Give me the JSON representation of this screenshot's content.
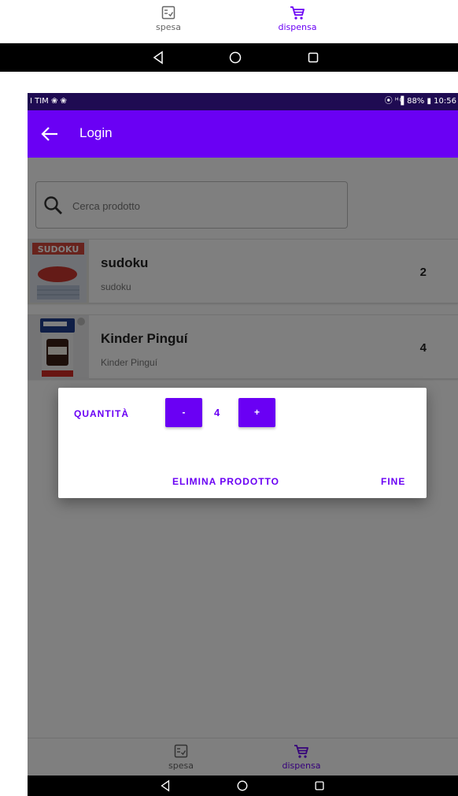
{
  "top_nav": {
    "items": [
      {
        "label": "spesa",
        "icon": "checklist-icon",
        "active": false
      },
      {
        "label": "dispensa",
        "icon": "cart-icon",
        "active": true
      }
    ]
  },
  "status_bar": {
    "carrier": "I TIM ❀ ❀",
    "right": "⦿ ᴴ ͩ▌88% ▮ 10:56",
    "battery": "88%",
    "time": "10:56"
  },
  "app_bar": {
    "title": "Login"
  },
  "search": {
    "placeholder": "Cerca prodotto"
  },
  "products": [
    {
      "name": "sudoku",
      "subtitle": "sudoku",
      "quantity": "2",
      "thumb_text": "SUDOKU"
    },
    {
      "name": "Kinder Pinguí",
      "subtitle": "Kinder Pinguí",
      "quantity": "4"
    }
  ],
  "bottom_nav": {
    "items": [
      {
        "label": "spesa",
        "icon": "checklist-icon",
        "active": false
      },
      {
        "label": "dispensa",
        "icon": "cart-icon",
        "active": true
      }
    ]
  },
  "dialog": {
    "quantity_label": "QUANTITÀ",
    "minus_label": "-",
    "value": "4",
    "plus_label": "+",
    "delete_label": "ELIMINA PRODOTTO",
    "done_label": "FINE"
  },
  "colors": {
    "accent": "#6a00f4",
    "status_bar": "#1f0b52",
    "inactive_icon": "#666666"
  }
}
